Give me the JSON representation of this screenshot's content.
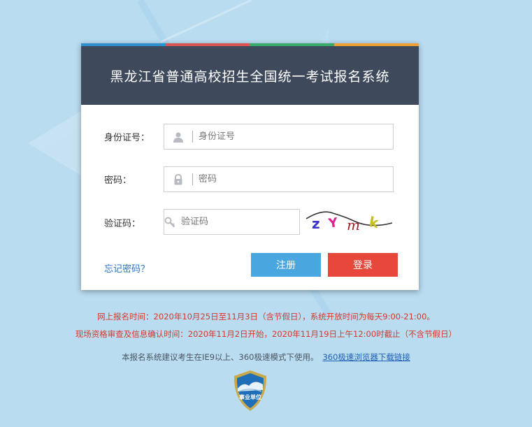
{
  "header": {
    "title": "黑龙江省普通高校招生全国统一考试报名系统"
  },
  "form": {
    "id_label": "身份证号：",
    "id_placeholder": "身份证号",
    "password_label": "密码：",
    "password_placeholder": "密码",
    "captcha_label": "验证码：",
    "captcha_placeholder": "验证码",
    "captcha_chars": [
      "z",
      "Y",
      "m",
      "k"
    ],
    "forgot_link": "忘记密码？",
    "register_button": "注册",
    "login_button": "登录"
  },
  "notices": {
    "line1": "网上报名时间：2020年10月25日至11月3日（含节假日），系统开放时间为每天9:00-21:00。",
    "line2": "现场资格审查及信息确认时间：2020年11月2日开始，2020年11月19日上午12:00时截止（不含节假日）"
  },
  "footer": {
    "tip_text": "本报名系统建议考生在IE9以上、360极速模式下使用。",
    "download_link": "360极速浏览器下载链接",
    "badge_text": "事业单位"
  },
  "icons": {
    "id": "user-icon",
    "password": "lock-icon",
    "captcha": "key-icon"
  },
  "colors": {
    "background": "#b9dcf0",
    "header_bg": "#3e4a5c",
    "stripe_blue": "#2f8fd0",
    "stripe_red": "#d9534f",
    "stripe_green": "#3aaa6a",
    "stripe_orange": "#f0a030",
    "register": "#4aa6de",
    "login": "#e8483c",
    "notice_text": "#d9362b",
    "link": "#2f72c4"
  }
}
